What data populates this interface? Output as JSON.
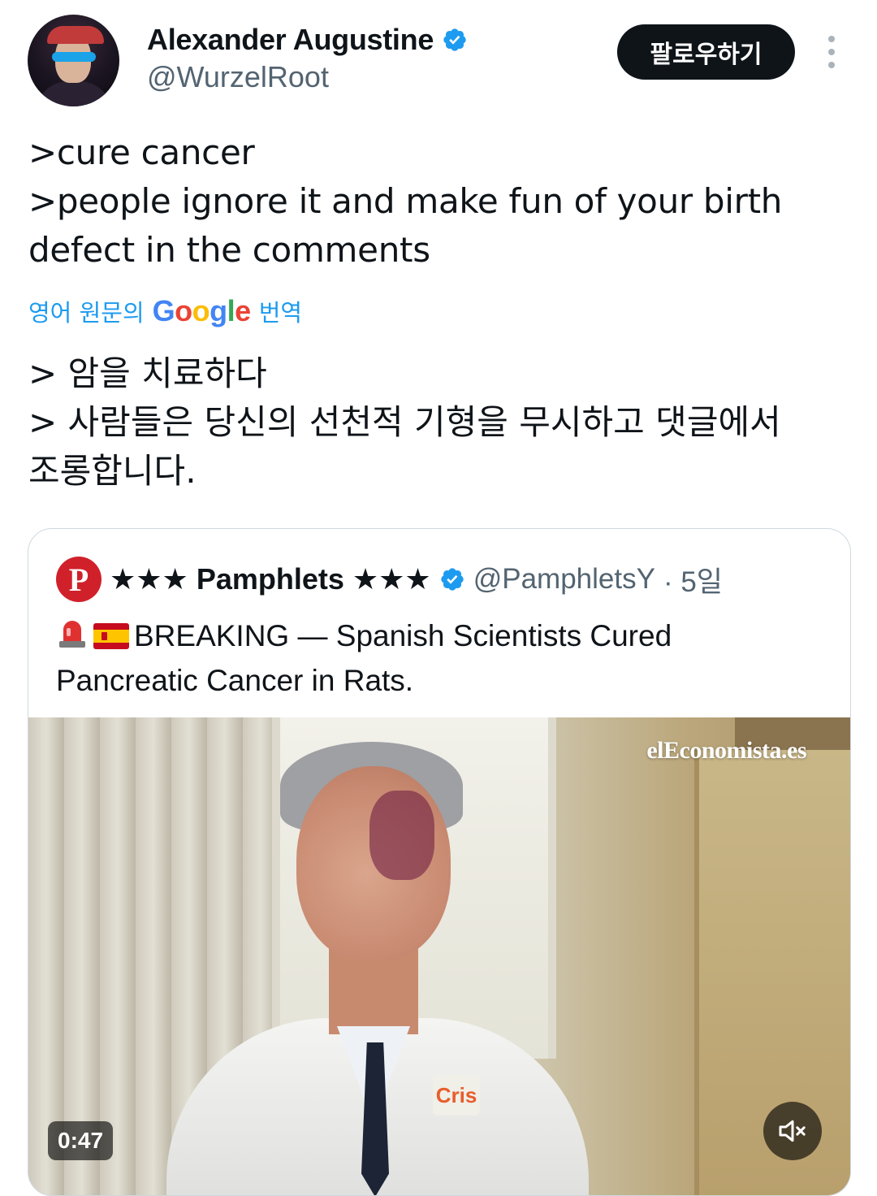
{
  "author": {
    "display_name": "Alexander Augustine",
    "handle": "@WurzelRoot"
  },
  "follow_button": {
    "label": "팔로우하기"
  },
  "tweet": {
    "lines": [
      ">cure cancer",
      ">people ignore it and make fun of your birth",
      "defect in the comments"
    ]
  },
  "translate": {
    "prefix": "영어 원문의",
    "brand": "Google",
    "suffix": "번역"
  },
  "translated": {
    "lines": [
      "> 암을 치료하다",
      "> 사람들은 당신의 선천적 기형을 무시하고 댓글에서",
      "조롱합니다."
    ]
  },
  "quote": {
    "avatar_letter": "P",
    "display_name": "★★★ Pamphlets ★★★",
    "handle": "@PamphletsY",
    "time": "· 5일",
    "text_line1": "BREAKING — Spanish Scientists Cured",
    "text_line2": "Pancreatic Cancer in Rats.",
    "emojis": [
      "siren",
      "spain-flag"
    ],
    "media": {
      "watermark": "elEconomista.es",
      "duration": "0:47",
      "coat_logo": "Cris"
    }
  },
  "colors": {
    "accent": "#1d9bf0",
    "text_primary": "#0f1419",
    "text_secondary": "#536471",
    "follow_bg": "#0f1419",
    "verified": "#1d9bf0",
    "pamphlets_red": "#d0212b"
  }
}
